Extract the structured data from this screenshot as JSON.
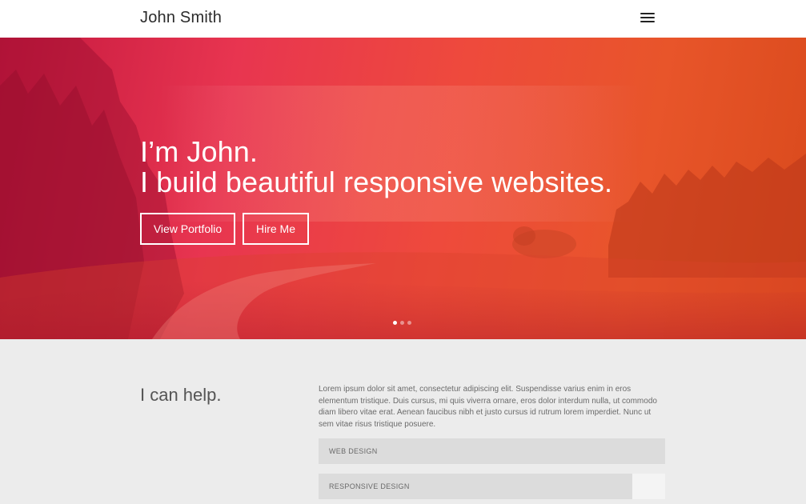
{
  "header": {
    "brand": "John Smith",
    "menu_icon": "hamburger-menu-icon"
  },
  "hero": {
    "line1": "I’m John.",
    "line2": "I build beautiful responsive websites.",
    "buttons": {
      "portfolio": "View Portfolio",
      "hire": "Hire Me"
    },
    "slides": {
      "count": 3,
      "active": 1
    },
    "colors": {
      "gradient_start": "#c4183f",
      "gradient_mid": "#ee4a3c",
      "gradient_end": "#d94a1c"
    }
  },
  "services": {
    "heading": "I can help.",
    "body": "Lorem ipsum dolor sit amet, consectetur adipiscing elit. Suspendisse varius enim in eros elementum tristique. Duis cursus, mi quis viverra ornare, eros dolor interdum nulla, ut commodo diam libero vitae erat. Aenean faucibus nibh et justo cursus id rutrum lorem imperdiet. Nunc ut sem vitae risus tristique posuere.",
    "accordion": [
      {
        "label": "WEB DESIGN"
      },
      {
        "label": "RESPONSIVE DESIGN"
      }
    ]
  }
}
